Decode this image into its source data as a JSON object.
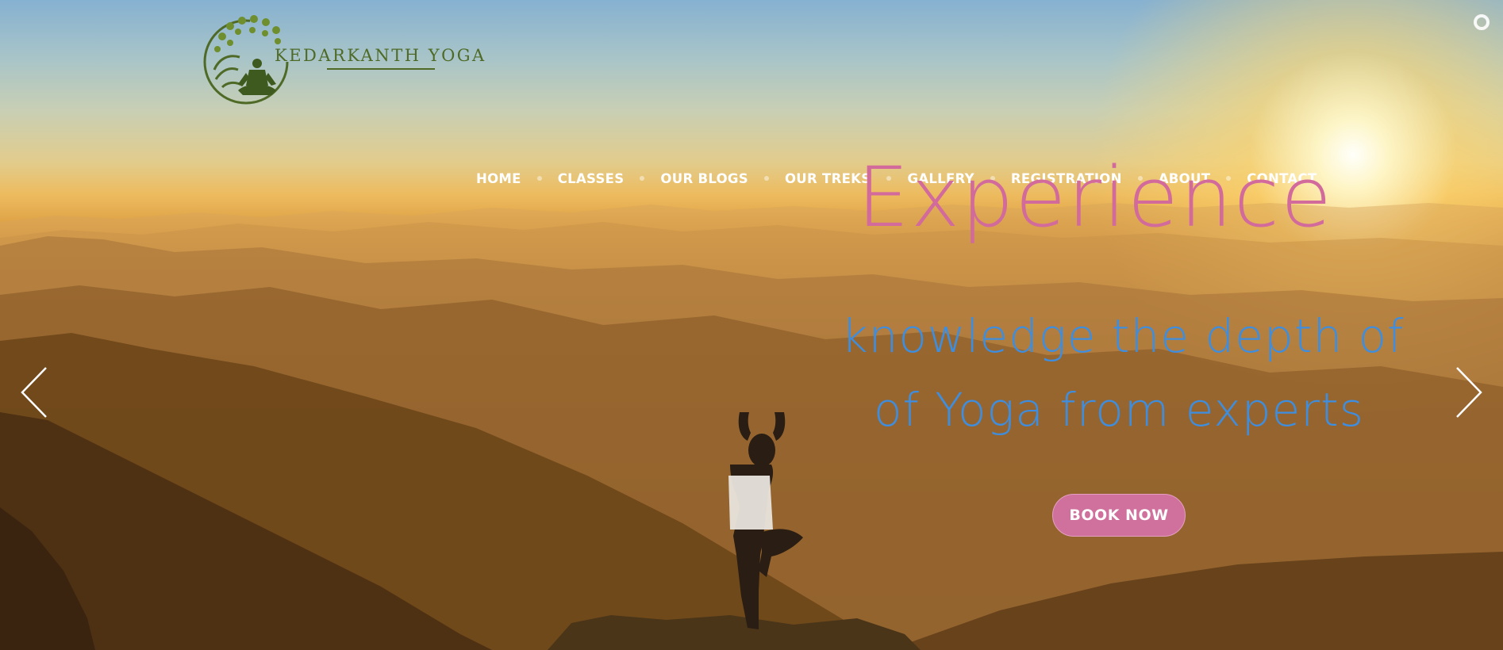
{
  "brand": {
    "name": "KEDARKANTH YOGA",
    "logo_icon": "tree-meditation-logo"
  },
  "nav": {
    "items": [
      {
        "label": "HOME"
      },
      {
        "label": "CLASSES"
      },
      {
        "label": "OUR BLOGS"
      },
      {
        "label": "OUR TREKS"
      },
      {
        "label": "GALLERY"
      },
      {
        "label": "REGISTRATION"
      },
      {
        "label": "ABOUT"
      },
      {
        "label": "CONTACT"
      }
    ]
  },
  "hero": {
    "headline": "Experience",
    "subline_1": "knowledge the depth of",
    "subline_2": "of Yoga from experts",
    "cta_label": "BOOK NOW"
  },
  "slider": {
    "prev_icon": "chevron-left-icon",
    "next_icon": "chevron-right-icon"
  },
  "colors": {
    "headline": "#d26a9c",
    "subline": "#3d8ee0",
    "cta_bg": "#d0709c",
    "logo_green": "#4e6a26",
    "nav_text": "#ffffff"
  }
}
